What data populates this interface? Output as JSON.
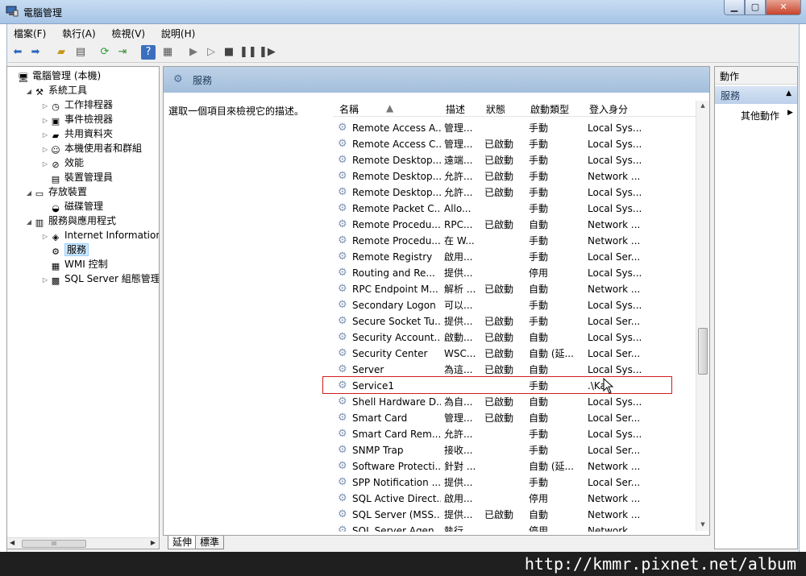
{
  "window": {
    "title": "電腦管理"
  },
  "menu": [
    "檔案(F)",
    "執行(A)",
    "檢視(V)",
    "說明(H)"
  ],
  "tree": [
    {
      "label": "電腦管理 (本機)",
      "level": 0,
      "arrow": "",
      "icon": "computer-icon"
    },
    {
      "label": "系統工具",
      "level": 1,
      "arrow": "◢",
      "icon": "tools-icon"
    },
    {
      "label": "工作排程器",
      "level": 2,
      "arrow": "▷",
      "icon": "clock-icon"
    },
    {
      "label": "事件檢視器",
      "level": 2,
      "arrow": "▷",
      "icon": "event-viewer-icon"
    },
    {
      "label": "共用資料夾",
      "level": 2,
      "arrow": "▷",
      "icon": "shared-folder-icon"
    },
    {
      "label": "本機使用者和群組",
      "level": 2,
      "arrow": "▷",
      "icon": "users-icon"
    },
    {
      "label": "效能",
      "level": 2,
      "arrow": "▷",
      "icon": "performance-icon"
    },
    {
      "label": "裝置管理員",
      "level": 2,
      "arrow": "",
      "icon": "device-manager-icon"
    },
    {
      "label": "存放裝置",
      "level": 1,
      "arrow": "◢",
      "icon": "storage-icon"
    },
    {
      "label": "磁碟管理",
      "level": 2,
      "arrow": "",
      "icon": "disk-icon"
    },
    {
      "label": "服務與應用程式",
      "level": 1,
      "arrow": "◢",
      "icon": "services-apps-icon"
    },
    {
      "label": "Internet Information Se",
      "level": 2,
      "arrow": "▷",
      "icon": "iis-icon"
    },
    {
      "label": "服務",
      "level": 2,
      "arrow": "",
      "icon": "gear-icon",
      "selected": true
    },
    {
      "label": "WMI 控制",
      "level": 2,
      "arrow": "",
      "icon": "wmi-icon"
    },
    {
      "label": "SQL Server 組態管理員",
      "level": 2,
      "arrow": "▷",
      "icon": "sql-icon"
    }
  ],
  "center": {
    "title": "服務",
    "description": "選取一個項目來檢視它的描述。",
    "columns": {
      "name": "名稱",
      "desc": "描述",
      "status": "狀態",
      "startup": "啟動類型",
      "logon": "登入身分"
    },
    "rows": [
      [
        "Remote Access A...",
        "管理...",
        "",
        "手動",
        "Local Sys..."
      ],
      [
        "Remote Access C...",
        "管理...",
        "已啟動",
        "手動",
        "Local Sys..."
      ],
      [
        "Remote Desktop...",
        "遠端...",
        "已啟動",
        "手動",
        "Local Sys..."
      ],
      [
        "Remote Desktop...",
        "允許...",
        "已啟動",
        "手動",
        "Network ..."
      ],
      [
        "Remote Desktop...",
        "允許...",
        "已啟動",
        "手動",
        "Local Sys..."
      ],
      [
        "Remote Packet C...",
        "Allo...",
        "",
        "手動",
        "Local Sys..."
      ],
      [
        "Remote Procedu...",
        "RPC...",
        "已啟動",
        "自動",
        "Network ..."
      ],
      [
        "Remote Procedu...",
        "在 W...",
        "",
        "手動",
        "Network ..."
      ],
      [
        "Remote Registry",
        "啟用...",
        "",
        "手動",
        "Local Ser..."
      ],
      [
        "Routing and Re...",
        "提供...",
        "",
        "停用",
        "Local Sys..."
      ],
      [
        "RPC Endpoint M...",
        "解析 ...",
        "已啟動",
        "自動",
        "Network ..."
      ],
      [
        "Secondary Logon",
        "可以...",
        "",
        "手動",
        "Local Sys..."
      ],
      [
        "Secure Socket Tu...",
        "提供...",
        "已啟動",
        "手動",
        "Local Ser..."
      ],
      [
        "Security Account...",
        "啟動...",
        "已啟動",
        "自動",
        "Local Sys..."
      ],
      [
        "Security Center",
        "WSC...",
        "已啟動",
        "自動 (延...",
        "Local Ser..."
      ],
      [
        "Server",
        "為這...",
        "已啟動",
        "自動",
        "Local Sys..."
      ],
      [
        "Service1",
        "",
        "",
        "手動",
        ".\\Ka"
      ],
      [
        "Shell Hardware D...",
        "為自...",
        "已啟動",
        "自動",
        "Local Sys..."
      ],
      [
        "Smart Card",
        "管理...",
        "已啟動",
        "自動",
        "Local Ser..."
      ],
      [
        "Smart Card Rem...",
        "允許...",
        "",
        "手動",
        "Local Sys..."
      ],
      [
        "SNMP Trap",
        "接收...",
        "",
        "手動",
        "Local Ser..."
      ],
      [
        "Software Protecti...",
        "針對 ...",
        "",
        "自動 (延...",
        "Network ..."
      ],
      [
        "SPP Notification ...",
        "提供...",
        "",
        "手動",
        "Local Ser..."
      ],
      [
        "SQL Active Direct...",
        "啟用...",
        "",
        "停用",
        "Network ..."
      ],
      [
        "SQL Server (MSS...",
        "提供...",
        "已啟動",
        "自動",
        "Network ..."
      ],
      [
        "SQL Server Agen...",
        "執行...",
        "",
        "停用",
        "Network ..."
      ]
    ]
  },
  "tabs": [
    "延伸",
    "標準"
  ],
  "actions": {
    "header": "動作",
    "section": "服務",
    "more": "其他動作"
  },
  "watermark": "http://kmmr.pixnet.net/album"
}
